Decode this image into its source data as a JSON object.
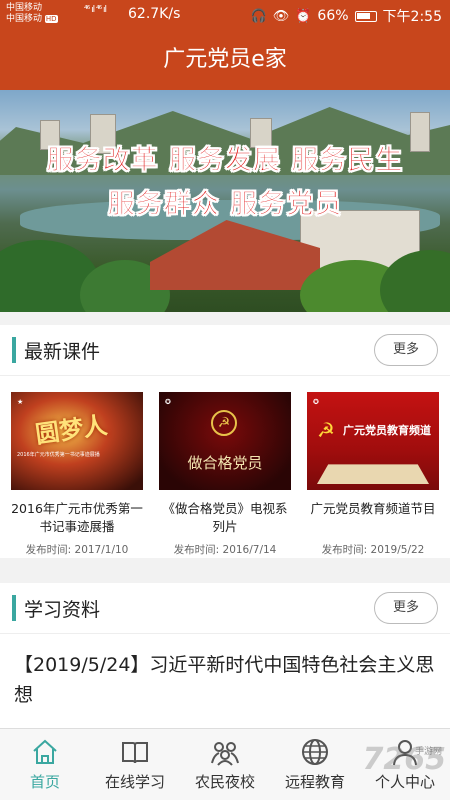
{
  "status_bar": {
    "carrier1": "中国移动",
    "carrier2": "中国移动",
    "network_badge": "HD",
    "signal": "⁴⁶ ıl ⁴⁶ ıl",
    "speed": "62.7K/s",
    "battery": "66%",
    "time": "下午2:55"
  },
  "app_bar": {
    "title": "广元党员e家"
  },
  "banner": {
    "slogan_line1": "服务改革 服务发展 服务民生",
    "slogan_line2": "服务群众 服务党员"
  },
  "courses": {
    "section_title": "最新课件",
    "more_label": "更多",
    "items": [
      {
        "title": "2016年广元市优秀第一书记事迹展播",
        "date": "发布时间: 2017/1/10",
        "thumb_text": "圆梦人",
        "thumb_caption": "2016年广元市优秀第一书记事迹展播"
      },
      {
        "title": "《做合格党员》电视系列片",
        "date": "发布时间: 2016/7/14",
        "thumb_text": "做合格党员"
      },
      {
        "title": "广元党员教育频道节目",
        "date": "发布时间: 2019/5/22",
        "thumb_text": "广元党员教育频道"
      }
    ]
  },
  "materials": {
    "section_title": "学习资料",
    "more_label": "更多",
    "items": [
      {
        "title": "【2019/5/24】习近平新时代中国特色社会主义思想"
      }
    ]
  },
  "tab_bar": {
    "colors": {
      "active": "#3aa7a0",
      "inactive": "#555555"
    },
    "items": [
      {
        "label": "首页",
        "icon": "home-icon"
      },
      {
        "label": "在线学习",
        "icon": "book-icon"
      },
      {
        "label": "农民夜校",
        "icon": "group-icon"
      },
      {
        "label": "远程教育",
        "icon": "globe-icon"
      },
      {
        "label": "个人中心",
        "icon": "person-icon"
      }
    ]
  },
  "watermark": {
    "text": "7265",
    "sub": "手游网"
  },
  "colors": {
    "brand": "#c8461c",
    "accent": "#3aa7a0",
    "slogan": "#e01414"
  }
}
